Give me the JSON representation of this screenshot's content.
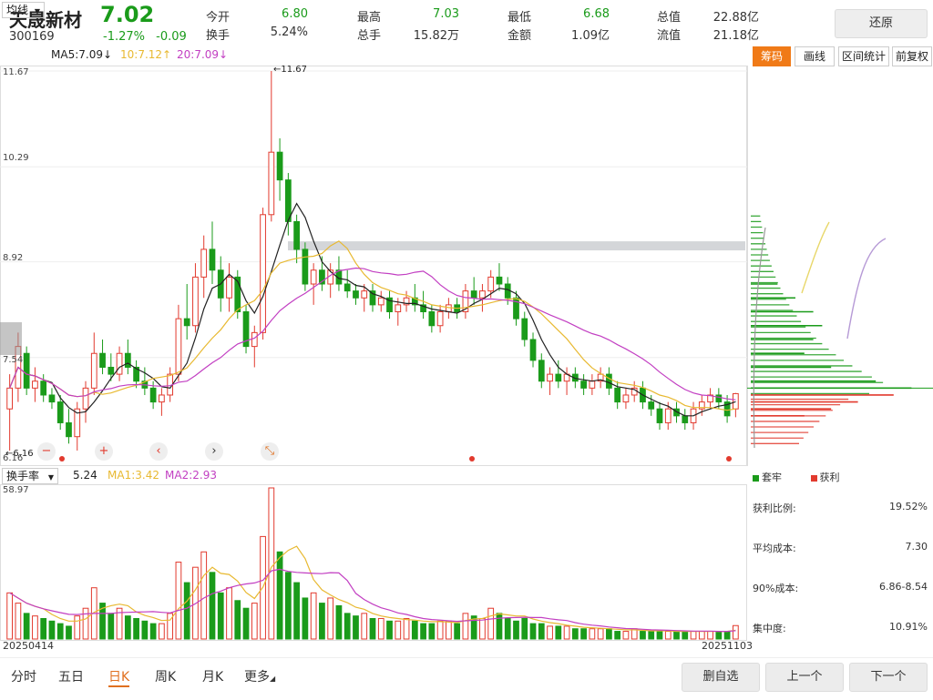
{
  "header": {
    "name": "天晟新材",
    "price": "7.02",
    "code": "300169",
    "change_pct": "-1.27%",
    "change_abs": "-0.09",
    "stats": [
      {
        "label": "今开",
        "value": "6.80",
        "color": "#1a9b1a"
      },
      {
        "label": "换手",
        "value": "5.24%",
        "color": "#333333"
      },
      {
        "label": "最高",
        "value": "7.03",
        "color": "#1a9b1a"
      },
      {
        "label": "总手",
        "value": "15.82万",
        "color": "#333333"
      },
      {
        "label": "最低",
        "value": "6.68",
        "color": "#1a9b1a"
      },
      {
        "label": "金额",
        "value": "1.09亿",
        "color": "#333333"
      },
      {
        "label": "总值",
        "value": "22.88亿",
        "color": "#333333"
      },
      {
        "label": "流值",
        "value": "21.18亿",
        "color": "#333333"
      }
    ],
    "restore_label": "还原"
  },
  "indicators": {
    "type_label": "均线",
    "ma5": "MA5:7.09↓",
    "ma10": "10:7.12↑",
    "ma20": "20:7.09↓"
  },
  "tabs": {
    "chip": "筹码",
    "draw": "画线",
    "range": "区间统计",
    "adjust": "前复权"
  },
  "price_axis": [
    "11.67",
    "10.29",
    "8.92",
    "7.54",
    "6.16"
  ],
  "annotations": {
    "high": "←11.67",
    "low": "←6.16"
  },
  "volume_bar": {
    "type_label": "换手率",
    "value": "5.24",
    "ma1": "MA1:3.42",
    "ma2": "MA2:2.93",
    "max": "58.97"
  },
  "dates": {
    "start": "20250414",
    "end": "20251103"
  },
  "chip_panel": {
    "legend_trapped": "套牢",
    "legend_profit": "获利",
    "rows": [
      {
        "label": "获利比例:",
        "value": "19.52%"
      },
      {
        "label": "平均成本:",
        "value": "7.30"
      },
      {
        "label": "90%成本:",
        "value": "6.86-8.54"
      },
      {
        "label": "集中度:",
        "value": "10.91%"
      }
    ]
  },
  "bottom_nav": {
    "tabs": [
      "分时",
      "五日",
      "日K",
      "周K",
      "月K",
      "更多"
    ],
    "buttons": [
      "删自选",
      "上一个",
      "下一个"
    ]
  },
  "colors": {
    "up": "#e23a2e",
    "down": "#1a9b1a",
    "ma5": "#222222",
    "ma10": "#e8b931",
    "ma20": "#c23fc2",
    "accent": "#f07a17"
  },
  "chart_data": {
    "type": "candlestick",
    "price_range": [
      6.16,
      11.67
    ],
    "candles": [
      {
        "o": 6.8,
        "h": 7.3,
        "l": 6.2,
        "c": 7.1
      },
      {
        "o": 7.1,
        "h": 7.9,
        "l": 6.9,
        "c": 7.7
      },
      {
        "o": 7.6,
        "h": 7.7,
        "l": 7.0,
        "c": 7.1
      },
      {
        "o": 7.1,
        "h": 7.4,
        "l": 6.9,
        "c": 7.2
      },
      {
        "o": 7.2,
        "h": 7.3,
        "l": 6.9,
        "c": 7.0
      },
      {
        "o": 7.0,
        "h": 7.1,
        "l": 6.8,
        "c": 6.9
      },
      {
        "o": 6.9,
        "h": 7.0,
        "l": 6.5,
        "c": 6.6
      },
      {
        "o": 6.6,
        "h": 6.8,
        "l": 6.3,
        "c": 6.4
      },
      {
        "o": 6.4,
        "h": 6.9,
        "l": 6.2,
        "c": 6.8
      },
      {
        "o": 6.8,
        "h": 7.2,
        "l": 6.6,
        "c": 7.1
      },
      {
        "o": 7.1,
        "h": 7.9,
        "l": 7.0,
        "c": 7.6
      },
      {
        "o": 7.6,
        "h": 7.8,
        "l": 7.3,
        "c": 7.4
      },
      {
        "o": 7.4,
        "h": 7.6,
        "l": 7.2,
        "c": 7.3
      },
      {
        "o": 7.3,
        "h": 7.7,
        "l": 7.2,
        "c": 7.6
      },
      {
        "o": 7.6,
        "h": 7.8,
        "l": 7.3,
        "c": 7.4
      },
      {
        "o": 7.4,
        "h": 7.5,
        "l": 7.1,
        "c": 7.2
      },
      {
        "o": 7.2,
        "h": 7.4,
        "l": 7.0,
        "c": 7.1
      },
      {
        "o": 7.1,
        "h": 7.2,
        "l": 6.8,
        "c": 6.9
      },
      {
        "o": 6.9,
        "h": 7.1,
        "l": 6.7,
        "c": 7.0
      },
      {
        "o": 7.0,
        "h": 7.4,
        "l": 6.9,
        "c": 7.3
      },
      {
        "o": 7.3,
        "h": 8.3,
        "l": 7.2,
        "c": 8.1
      },
      {
        "o": 8.1,
        "h": 8.6,
        "l": 7.8,
        "c": 8.0
      },
      {
        "o": 8.0,
        "h": 8.9,
        "l": 7.9,
        "c": 8.7
      },
      {
        "o": 8.7,
        "h": 9.3,
        "l": 8.4,
        "c": 9.1
      },
      {
        "o": 9.1,
        "h": 9.5,
        "l": 8.6,
        "c": 8.8
      },
      {
        "o": 8.8,
        "h": 9.0,
        "l": 8.2,
        "c": 8.4
      },
      {
        "o": 8.4,
        "h": 8.9,
        "l": 8.2,
        "c": 8.7
      },
      {
        "o": 8.7,
        "h": 8.8,
        "l": 8.1,
        "c": 8.2
      },
      {
        "o": 8.2,
        "h": 8.3,
        "l": 7.6,
        "c": 7.7
      },
      {
        "o": 7.7,
        "h": 8.0,
        "l": 7.4,
        "c": 7.9
      },
      {
        "o": 7.9,
        "h": 9.7,
        "l": 7.8,
        "c": 9.6
      },
      {
        "o": 9.6,
        "h": 11.67,
        "l": 9.5,
        "c": 10.5
      },
      {
        "o": 10.5,
        "h": 10.7,
        "l": 9.8,
        "c": 10.1
      },
      {
        "o": 10.1,
        "h": 10.2,
        "l": 9.3,
        "c": 9.5
      },
      {
        "o": 9.5,
        "h": 9.6,
        "l": 8.9,
        "c": 9.1
      },
      {
        "o": 9.1,
        "h": 9.2,
        "l": 8.5,
        "c": 8.6
      },
      {
        "o": 8.6,
        "h": 8.9,
        "l": 8.3,
        "c": 8.8
      },
      {
        "o": 8.8,
        "h": 9.0,
        "l": 8.5,
        "c": 8.6
      },
      {
        "o": 8.6,
        "h": 8.9,
        "l": 8.4,
        "c": 8.8
      },
      {
        "o": 8.8,
        "h": 9.0,
        "l": 8.5,
        "c": 8.6
      },
      {
        "o": 8.6,
        "h": 8.8,
        "l": 8.4,
        "c": 8.5
      },
      {
        "o": 8.5,
        "h": 8.6,
        "l": 8.3,
        "c": 8.4
      },
      {
        "o": 8.4,
        "h": 8.6,
        "l": 8.2,
        "c": 8.5
      },
      {
        "o": 8.5,
        "h": 8.6,
        "l": 8.2,
        "c": 8.3
      },
      {
        "o": 8.3,
        "h": 8.5,
        "l": 8.2,
        "c": 8.4
      },
      {
        "o": 8.4,
        "h": 8.5,
        "l": 8.1,
        "c": 8.2
      },
      {
        "o": 8.2,
        "h": 8.4,
        "l": 8.0,
        "c": 8.3
      },
      {
        "o": 8.3,
        "h": 8.5,
        "l": 8.2,
        "c": 8.4
      },
      {
        "o": 8.4,
        "h": 8.6,
        "l": 8.2,
        "c": 8.3
      },
      {
        "o": 8.3,
        "h": 8.5,
        "l": 8.1,
        "c": 8.2
      },
      {
        "o": 8.2,
        "h": 8.3,
        "l": 7.9,
        "c": 8.0
      },
      {
        "o": 8.0,
        "h": 8.3,
        "l": 7.9,
        "c": 8.2
      },
      {
        "o": 8.2,
        "h": 8.4,
        "l": 8.1,
        "c": 8.3
      },
      {
        "o": 8.3,
        "h": 8.4,
        "l": 8.1,
        "c": 8.2
      },
      {
        "o": 8.2,
        "h": 8.6,
        "l": 8.1,
        "c": 8.5
      },
      {
        "o": 8.5,
        "h": 8.7,
        "l": 8.3,
        "c": 8.4
      },
      {
        "o": 8.4,
        "h": 8.6,
        "l": 8.2,
        "c": 8.5
      },
      {
        "o": 8.5,
        "h": 8.8,
        "l": 8.4,
        "c": 8.7
      },
      {
        "o": 8.7,
        "h": 8.9,
        "l": 8.5,
        "c": 8.6
      },
      {
        "o": 8.6,
        "h": 8.7,
        "l": 8.3,
        "c": 8.4
      },
      {
        "o": 8.4,
        "h": 8.5,
        "l": 8.0,
        "c": 8.1
      },
      {
        "o": 8.1,
        "h": 8.2,
        "l": 7.7,
        "c": 7.8
      },
      {
        "o": 7.8,
        "h": 7.9,
        "l": 7.4,
        "c": 7.5
      },
      {
        "o": 7.5,
        "h": 7.6,
        "l": 7.1,
        "c": 7.2
      },
      {
        "o": 7.2,
        "h": 7.4,
        "l": 7.0,
        "c": 7.3
      },
      {
        "o": 7.3,
        "h": 7.5,
        "l": 7.1,
        "c": 7.2
      },
      {
        "o": 7.2,
        "h": 7.4,
        "l": 7.0,
        "c": 7.3
      },
      {
        "o": 7.3,
        "h": 7.4,
        "l": 7.1,
        "c": 7.2
      },
      {
        "o": 7.2,
        "h": 7.3,
        "l": 7.0,
        "c": 7.1
      },
      {
        "o": 7.1,
        "h": 7.3,
        "l": 7.0,
        "c": 7.2
      },
      {
        "o": 7.2,
        "h": 7.4,
        "l": 7.1,
        "c": 7.3
      },
      {
        "o": 7.3,
        "h": 7.4,
        "l": 7.0,
        "c": 7.1
      },
      {
        "o": 7.1,
        "h": 7.2,
        "l": 6.8,
        "c": 6.9
      },
      {
        "o": 6.9,
        "h": 7.1,
        "l": 6.8,
        "c": 7.0
      },
      {
        "o": 7.0,
        "h": 7.2,
        "l": 6.9,
        "c": 7.1
      },
      {
        "o": 7.1,
        "h": 7.2,
        "l": 6.8,
        "c": 6.9
      },
      {
        "o": 6.9,
        "h": 7.0,
        "l": 6.7,
        "c": 6.8
      },
      {
        "o": 6.8,
        "h": 6.9,
        "l": 6.5,
        "c": 6.6
      },
      {
        "o": 6.6,
        "h": 6.9,
        "l": 6.5,
        "c": 6.8
      },
      {
        "o": 6.8,
        "h": 6.9,
        "l": 6.6,
        "c": 6.7
      },
      {
        "o": 6.7,
        "h": 6.8,
        "l": 6.5,
        "c": 6.6
      },
      {
        "o": 6.6,
        "h": 6.9,
        "l": 6.5,
        "c": 6.8
      },
      {
        "o": 6.8,
        "h": 7.0,
        "l": 6.7,
        "c": 6.9
      },
      {
        "o": 6.9,
        "h": 7.1,
        "l": 6.8,
        "c": 7.0
      },
      {
        "o": 7.0,
        "h": 7.1,
        "l": 6.8,
        "c": 6.9
      },
      {
        "o": 6.9,
        "h": 7.0,
        "l": 6.6,
        "c": 6.7
      },
      {
        "o": 6.8,
        "h": 7.03,
        "l": 6.68,
        "c": 7.02
      }
    ],
    "turnover": [
      18,
      14,
      10,
      9,
      8,
      7,
      6,
      5,
      9,
      12,
      20,
      14,
      10,
      12,
      9,
      8,
      7,
      6,
      6,
      10,
      30,
      22,
      28,
      34,
      26,
      18,
      20,
      15,
      12,
      14,
      40,
      58.97,
      34,
      26,
      22,
      16,
      18,
      14,
      16,
      13,
      10,
      9,
      10,
      8,
      8,
      7,
      7,
      8,
      7,
      6,
      6,
      7,
      7,
      6,
      10,
      9,
      8,
      12,
      10,
      8,
      7,
      8,
      6,
      6,
      5,
      5,
      5,
      4,
      4,
      4,
      4,
      4,
      3,
      3,
      4,
      3,
      3,
      3,
      3,
      3,
      3,
      3,
      3,
      3,
      3,
      3,
      5.24
    ],
    "chip_levels": [
      {
        "price": 8.6,
        "len": 0.15,
        "type": "trapped"
      },
      {
        "price": 8.4,
        "len": 0.25,
        "type": "trapped"
      },
      {
        "price": 8.2,
        "len": 0.35,
        "type": "trapped"
      },
      {
        "price": 8.0,
        "len": 0.4,
        "type": "trapped"
      },
      {
        "price": 7.8,
        "len": 0.35,
        "type": "trapped"
      },
      {
        "price": 7.6,
        "len": 0.3,
        "type": "trapped"
      },
      {
        "price": 7.4,
        "len": 0.45,
        "type": "trapped"
      },
      {
        "price": 7.2,
        "len": 0.7,
        "type": "trapped"
      },
      {
        "price": 7.1,
        "len": 0.9,
        "type": "trapped"
      },
      {
        "price": 7.0,
        "len": 0.8,
        "type": "profit"
      },
      {
        "price": 6.9,
        "len": 0.6,
        "type": "profit"
      },
      {
        "price": 6.8,
        "len": 0.45,
        "type": "profit"
      },
      {
        "price": 6.7,
        "len": 0.3,
        "type": "profit"
      }
    ]
  }
}
